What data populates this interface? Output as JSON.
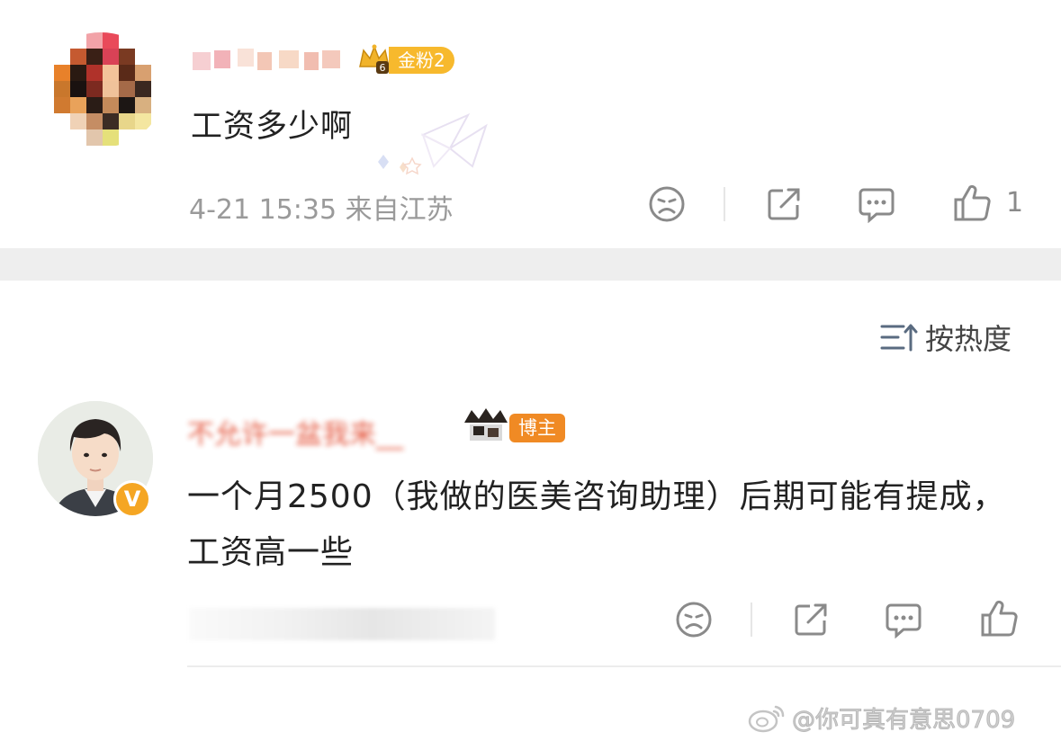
{
  "comment1": {
    "fan_badge": "金粉2",
    "fan_level_digit": "6",
    "text": "工资多少啊",
    "meta": "4-21 15:35 来自江苏",
    "like_count": "1"
  },
  "sort": {
    "label": "按热度"
  },
  "comment2": {
    "username": "不允许一盆我来__",
    "host_badge": "博主",
    "verified_mark": "V",
    "text": "一个月2500（我做的医美咨询助理）后期可能有提成，工资高一些"
  },
  "watermark": {
    "text": "@你可真有意思0709"
  },
  "colors": {
    "fan_badge": "#f7b92d",
    "host_badge": "#f08a24",
    "verified": "#f5a623",
    "meta_gray": "#9a9a9a",
    "icon_gray": "#8a8a8a"
  }
}
